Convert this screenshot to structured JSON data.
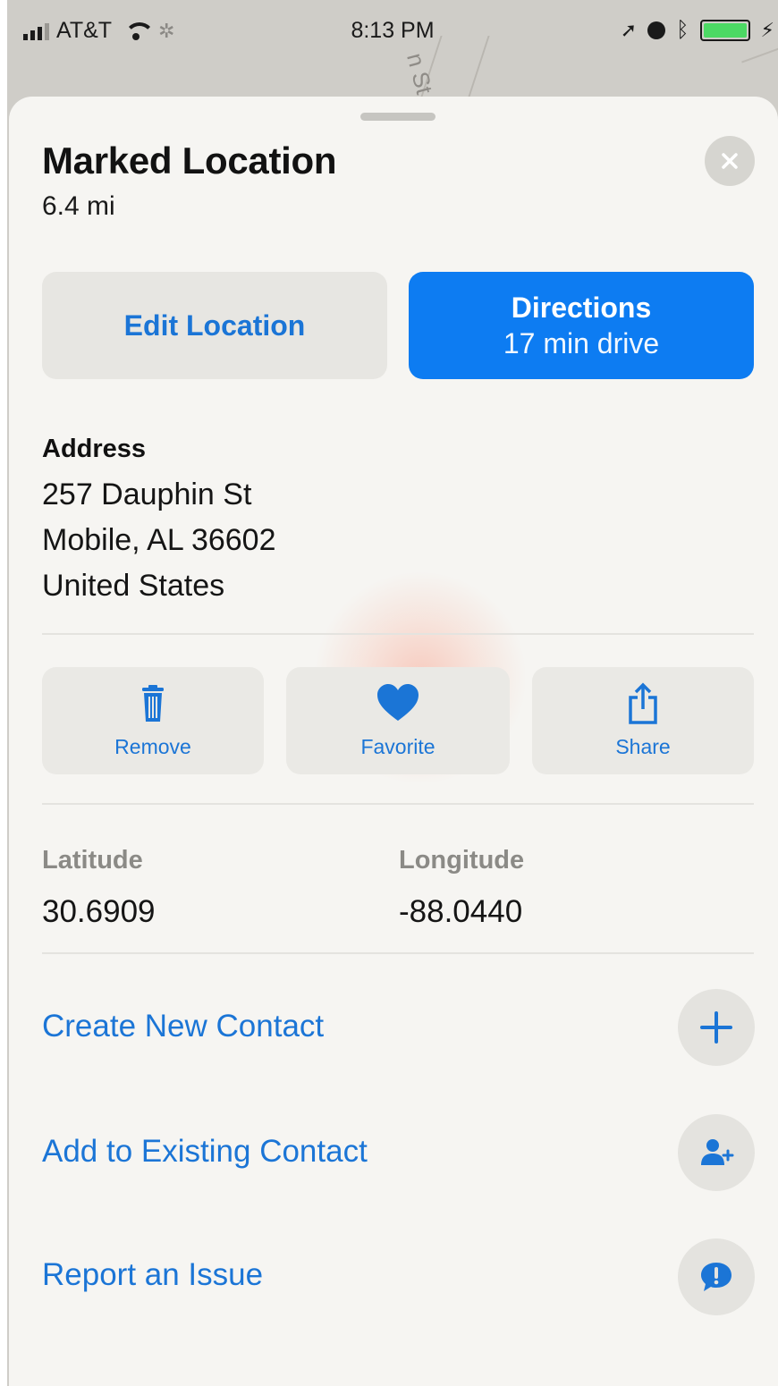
{
  "status_bar": {
    "carrier": "AT&T",
    "time": "8:13 PM",
    "battery_color": "#4cd964"
  },
  "map": {
    "street_label": "n St"
  },
  "place": {
    "title": "Marked Location",
    "distance": "6.4 mi"
  },
  "buttons": {
    "edit_location": "Edit Location",
    "directions": "Directions",
    "directions_sub": "17 min drive",
    "accent_color": "#0d7cf2"
  },
  "address": {
    "label": "Address",
    "line1": "257 Dauphin St",
    "line2": "Mobile, AL  36602",
    "line3": "United States"
  },
  "actions": [
    {
      "label": "Remove",
      "icon": "trash-icon"
    },
    {
      "label": "Favorite",
      "icon": "heart-icon"
    },
    {
      "label": "Share",
      "icon": "share-icon"
    }
  ],
  "coordinates": {
    "latitude_label": "Latitude",
    "latitude": "30.6909",
    "longitude_label": "Longitude",
    "longitude": "-88.0440"
  },
  "links": [
    {
      "label": "Create New Contact",
      "icon": "plus-icon"
    },
    {
      "label": "Add to Existing Contact",
      "icon": "add-person-icon"
    },
    {
      "label": "Report an Issue",
      "icon": "report-bubble-icon"
    }
  ]
}
